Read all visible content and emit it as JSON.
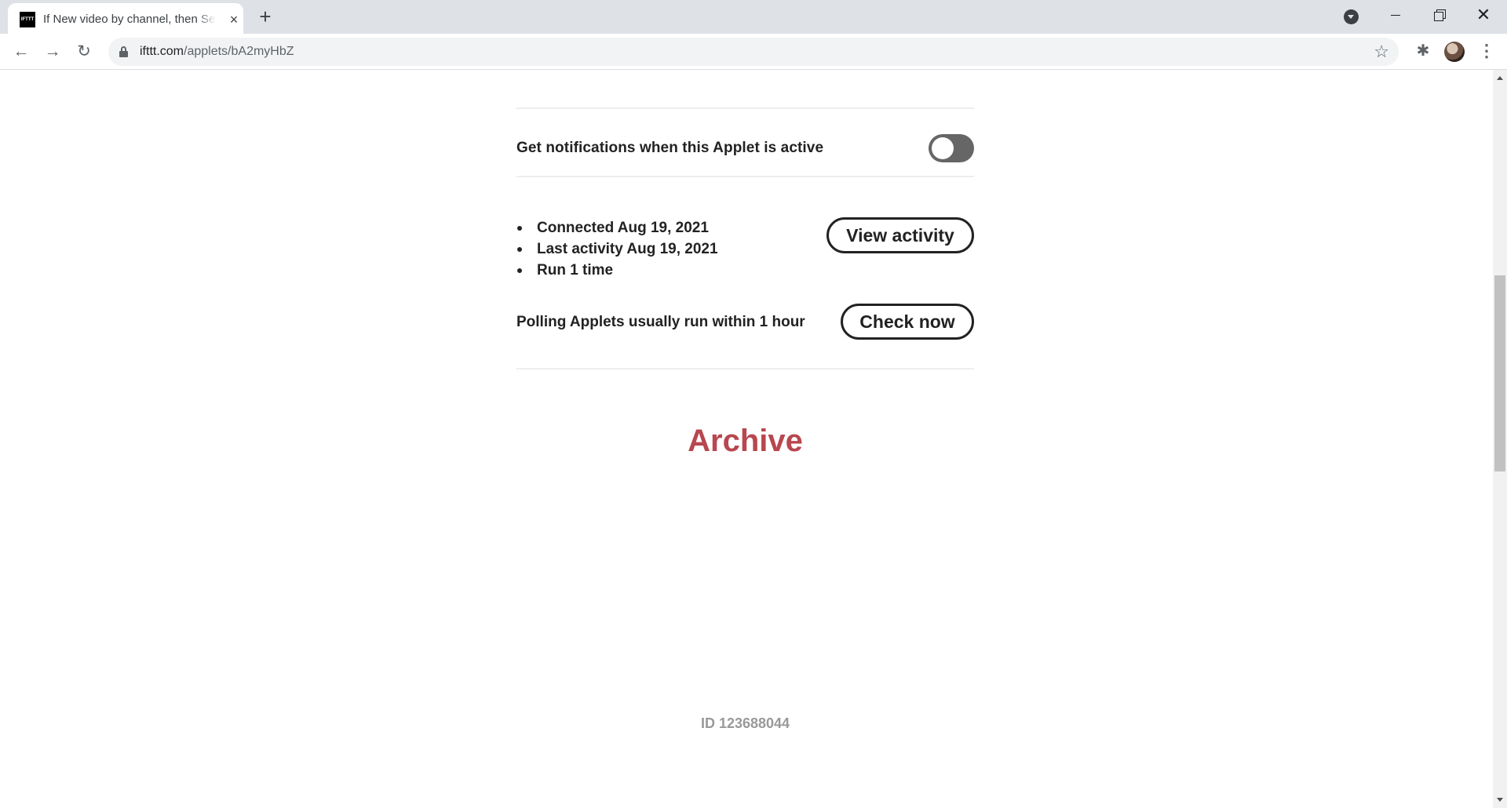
{
  "browser": {
    "tab": {
      "favicon_text": "IFTTT",
      "title": "If New video by channel, then Se",
      "close_icon": "×"
    },
    "new_tab_icon": "+",
    "window": {
      "close_icon": "✕"
    },
    "nav": {
      "back_icon": "←",
      "forward_icon": "→",
      "reload_icon": "↻"
    },
    "address": {
      "host": "ifttt.com",
      "path": "/applets/bA2myHbZ"
    },
    "star_icon": "☆",
    "extensions_icon": "✱",
    "menu_icon": "⋮"
  },
  "page": {
    "notifications_label": "Get notifications when this Applet is active",
    "notifications_enabled": false,
    "stats": [
      "Connected Aug 19, 2021",
      "Last activity Aug 19, 2021",
      "Run 1 time"
    ],
    "view_activity_label": "View activity",
    "polling_text": "Polling Applets usually run within 1 hour",
    "check_now_label": "Check now",
    "archive_label": "Archive",
    "applet_id": "ID 123688044"
  },
  "colors": {
    "archive": "#b8474f",
    "toggle_off": "#666666",
    "id_text": "#999999"
  }
}
